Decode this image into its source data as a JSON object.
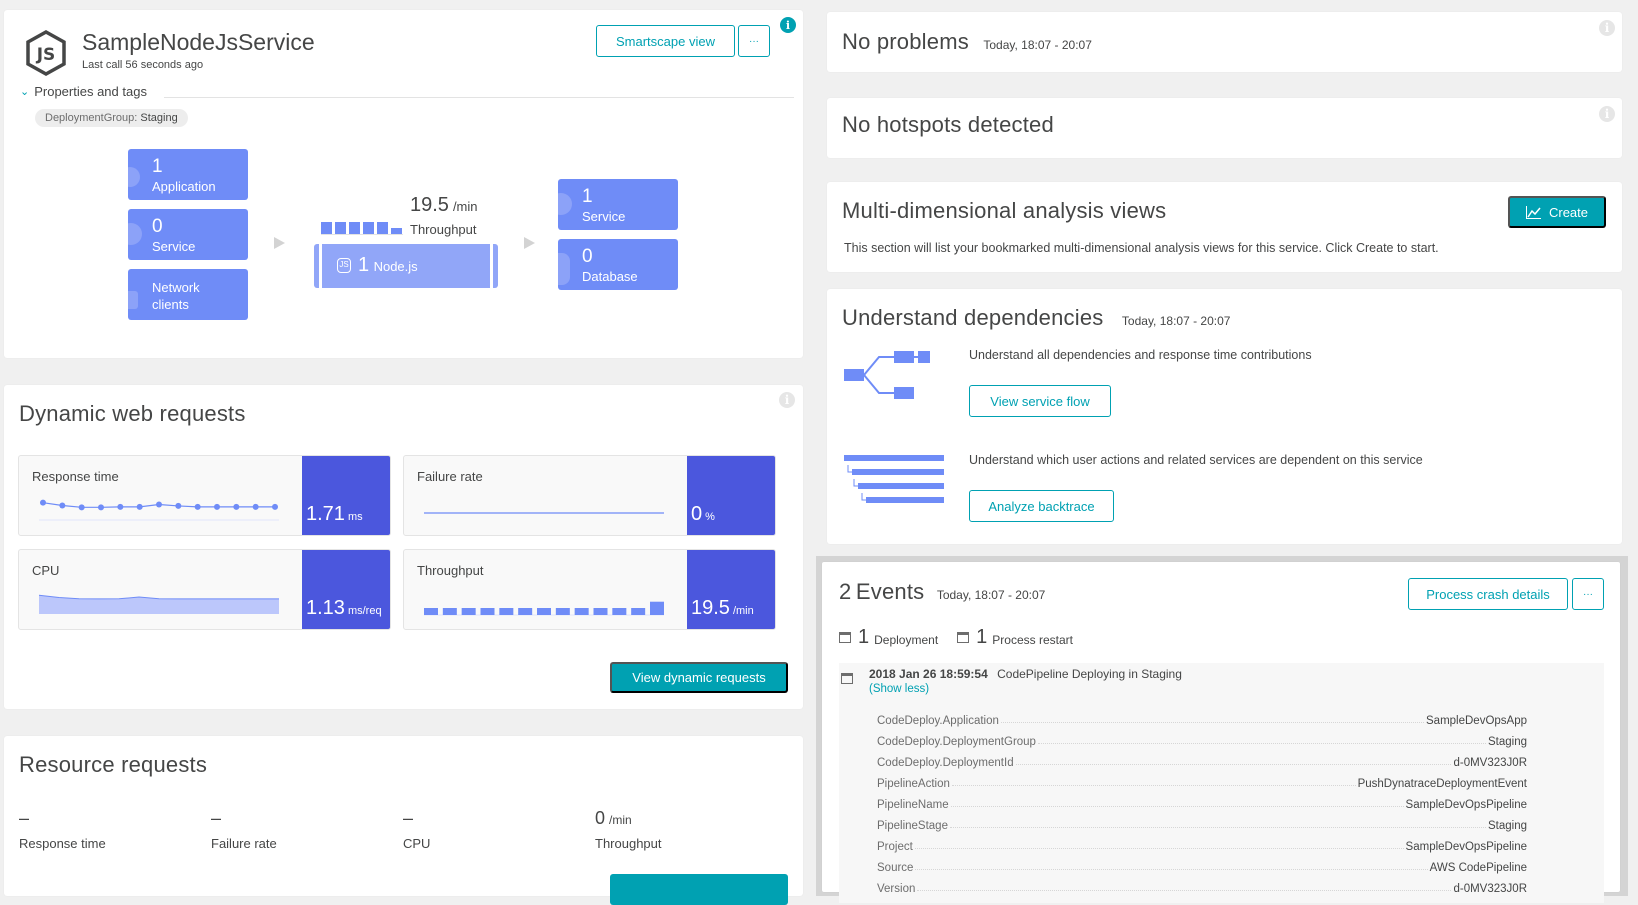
{
  "service": {
    "name": "SampleNodeJsService",
    "last_call": "Last call 56 seconds ago",
    "smartscape_button": "Smartscape view",
    "more_button": "···",
    "properties_toggle": "Properties and tags",
    "tag_key": "DeploymentGroup:",
    "tag_value": "Staging"
  },
  "flow": {
    "callers": [
      {
        "count": "1",
        "label": "Application"
      },
      {
        "count": "0",
        "label": "Service"
      },
      {
        "count": "",
        "label": "Network clients"
      }
    ],
    "throughput_value": "19.5",
    "throughput_unit": "/min",
    "throughput_label": "Throughput",
    "throughput_bars": [
      1,
      1,
      1,
      1,
      1,
      0.5
    ],
    "process_count": "1",
    "process_label": "Node.js",
    "callees": [
      {
        "count": "1",
        "label": "Service"
      },
      {
        "count": "0",
        "label": "Database"
      }
    ]
  },
  "dynamic": {
    "title": "Dynamic web requests",
    "metrics": [
      {
        "label": "Response time",
        "value": "1.71",
        "unit": "ms",
        "series": [
          1.8,
          1.74,
          1.7,
          1.7,
          1.71,
          1.71,
          1.76,
          1.73,
          1.71,
          1.71,
          1.71,
          1.71,
          1.71
        ]
      },
      {
        "label": "Failure rate",
        "value": "0",
        "unit": "%",
        "series": [
          0,
          0,
          0,
          0,
          0,
          0,
          0,
          0,
          0,
          0,
          0,
          0,
          0
        ]
      },
      {
        "label": "CPU",
        "value": "1.13",
        "unit": "ms/req",
        "series": [
          1.2,
          1.15,
          1.13,
          1.12,
          1.13,
          1.16,
          1.13,
          1.12,
          1.12,
          1.12,
          1.12,
          1.12,
          1.12
        ]
      },
      {
        "label": "Throughput",
        "value": "19.5",
        "unit": "/min",
        "series": [
          1,
          1,
          1,
          1,
          1,
          1,
          1,
          1,
          1,
          1,
          1,
          1,
          1.9
        ]
      }
    ],
    "view_button": "View dynamic requests"
  },
  "resource": {
    "title": "Resource requests",
    "metrics": [
      {
        "value": "–",
        "unit": "",
        "label": "Response time"
      },
      {
        "value": "–",
        "unit": "",
        "label": "Failure rate"
      },
      {
        "value": "–",
        "unit": "",
        "label": "CPU"
      },
      {
        "value": "0",
        "unit": "/min",
        "label": "Throughput"
      }
    ]
  },
  "problems": {
    "title": "No problems",
    "timeframe": "Today, 18:07 - 20:07"
  },
  "hotspots": {
    "title": "No hotspots detected"
  },
  "mda": {
    "title": "Multi-dimensional analysis views",
    "create_button": "Create",
    "description": "This section will list your bookmarked multi-dimensional analysis views for this service. Click Create to start."
  },
  "dependencies": {
    "title": "Understand dependencies",
    "timeframe": "Today, 18:07 - 20:07",
    "flow_text": "Understand all dependencies and response time contributions",
    "flow_button": "View service flow",
    "backtrace_text": "Understand which user actions and related services are dependent on this service",
    "backtrace_button": "Analyze backtrace"
  },
  "events": {
    "count": "2",
    "title": "Events",
    "timeframe": "Today, 18:07 - 20:07",
    "crash_button": "Process crash details",
    "more_button": "···",
    "summary": [
      {
        "count": "1",
        "label": "Deployment"
      },
      {
        "count": "1",
        "label": "Process restart"
      }
    ],
    "entry": {
      "timestamp": "2018 Jan 26 18:59:54",
      "title": "CodePipeline Deploying in Staging",
      "toggle": "(Show less)",
      "properties": [
        {
          "key": "CodeDeploy.Application",
          "value": "SampleDevOpsApp"
        },
        {
          "key": "CodeDeploy.DeploymentGroup",
          "value": "Staging"
        },
        {
          "key": "CodeDeploy.DeploymentId",
          "value": "d-0MV323J0R"
        },
        {
          "key": "PipelineAction",
          "value": "PushDynatraceDeploymentEvent"
        },
        {
          "key": "PipelineName",
          "value": "SampleDevOpsPipeline"
        },
        {
          "key": "PipelineStage",
          "value": "Staging"
        },
        {
          "key": "Project",
          "value": "SampleDevOpsPipeline"
        },
        {
          "key": "Source",
          "value": "AWS CodePipeline"
        },
        {
          "key": "Version",
          "value": "d-0MV323J0R"
        }
      ]
    }
  },
  "colors": {
    "accent": "#00a1b2",
    "tile": "#6f8cf7",
    "metric": "#4b57dd"
  }
}
